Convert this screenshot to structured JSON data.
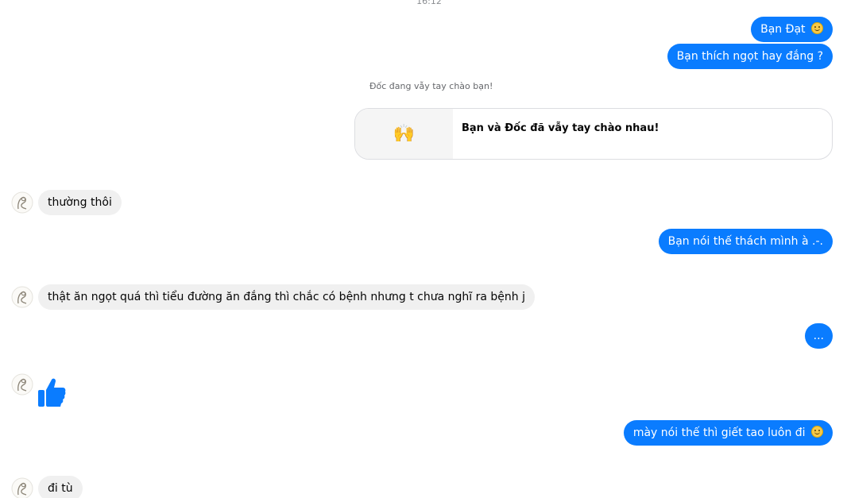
{
  "chat": {
    "timestamp": "16:12",
    "system_note": "Đốc đang vẫy tay chào bạn!",
    "wave_card": {
      "emoji": "🙌",
      "text": "Bạn và Đốc đã vẫy tay chào nhau!"
    },
    "messages": [
      {
        "side": "outgoing",
        "text": "Bạn Đạt",
        "emoji": "slightly-smiling-face"
      },
      {
        "side": "outgoing",
        "text": "Bạn thích ngọt hay đắng ?"
      },
      {
        "side": "incoming",
        "text": "thường thôi"
      },
      {
        "side": "outgoing",
        "text": "Bạn nói thế thách mình à .-."
      },
      {
        "side": "incoming",
        "text": "thật ăn ngọt quá thì tiểu đường ăn đắng thì chắc có bệnh nhưng t chưa nghĩ ra bệnh j"
      },
      {
        "side": "outgoing",
        "text": "..."
      },
      {
        "side": "incoming",
        "type": "like",
        "icon": "thumbs-up-icon"
      },
      {
        "side": "outgoing",
        "text": "mày nói thế thì giết tao luôn đi",
        "emoji": "slightly-smiling-face"
      },
      {
        "side": "incoming",
        "text": "đi tù"
      }
    ]
  },
  "colors": {
    "outgoing_bubble": "#0a7cff",
    "incoming_bubble": "#f0f0f0",
    "like_icon": "#0a7cff"
  }
}
